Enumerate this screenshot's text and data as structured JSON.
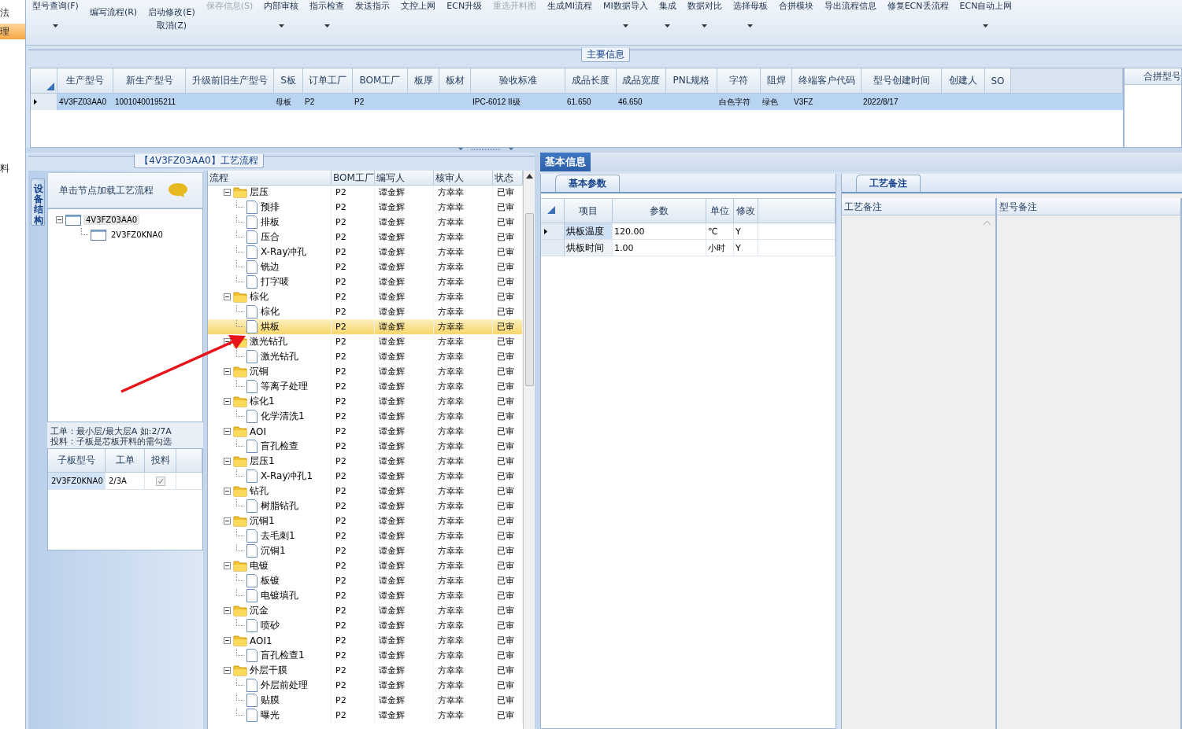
{
  "left_strip": [
    {
      "label": "法",
      "selected": false
    },
    {
      "label": "理",
      "selected": true
    },
    {
      "label": "料",
      "selected": false
    }
  ],
  "toolbar": [
    {
      "label": "型号查询(F)",
      "kind": "top",
      "disabled": false,
      "dropdown": true
    },
    {
      "label": "编写流程(R)",
      "kind": "large",
      "disabled": false,
      "dropdown": false
    },
    {
      "label": "启动修改(E)",
      "kind": "large",
      "disabled": false,
      "dropdown": false,
      "secondary": "取消(Z)"
    },
    {
      "label": "保存信息(S)",
      "kind": "top",
      "disabled": true,
      "dropdown": false
    },
    {
      "label": "内部审核",
      "kind": "top",
      "disabled": false,
      "dropdown": true
    },
    {
      "label": "指示检查",
      "kind": "top",
      "disabled": false,
      "dropdown": true
    },
    {
      "label": "发送指示",
      "kind": "top",
      "disabled": false,
      "dropdown": false
    },
    {
      "label": "文控上网",
      "kind": "top",
      "disabled": false,
      "dropdown": false
    },
    {
      "label": "ECN升级",
      "kind": "top",
      "disabled": false,
      "dropdown": false
    },
    {
      "label": "重选开料图",
      "kind": "top",
      "disabled": true,
      "dropdown": false
    },
    {
      "label": "生成MI流程",
      "kind": "top",
      "disabled": false,
      "dropdown": false
    },
    {
      "label": "MI数据导入",
      "kind": "top",
      "disabled": false,
      "dropdown": true
    },
    {
      "label": "集成",
      "kind": "top",
      "disabled": false,
      "dropdown": true
    },
    {
      "label": "数据对比",
      "kind": "top",
      "disabled": false,
      "dropdown": true
    },
    {
      "label": "选择母板",
      "kind": "top",
      "disabled": false,
      "dropdown": true
    },
    {
      "label": "合拼模块",
      "kind": "top",
      "disabled": false,
      "dropdown": false
    },
    {
      "label": "导出流程信息",
      "kind": "top",
      "disabled": false,
      "dropdown": false
    },
    {
      "label": "修复ECN丢流程",
      "kind": "top",
      "disabled": false,
      "dropdown": false
    },
    {
      "label": "ECN自动上网",
      "kind": "top",
      "disabled": false,
      "dropdown": true
    }
  ],
  "main_info": {
    "title": "主要信息",
    "columns": [
      "生产型号",
      "新生产型号",
      "升级前旧生产型号",
      "S板",
      "订单工厂",
      "BOM工厂",
      "板厚",
      "板材",
      "验收标准",
      "成品长度",
      "成品宽度",
      "PNL规格",
      "字符",
      "阻焊",
      "终端客户代码",
      "型号创建时间",
      "创建人",
      "SO"
    ],
    "rows": [
      {
        "current": true,
        "cells": [
          "4V3FZ03AA0",
          "10010400195211",
          null,
          "母板",
          "P2",
          "P2",
          null,
          null,
          "IPC-6012 II级",
          "61.650",
          "46.650",
          null,
          "白色字符",
          "绿色",
          "V3FZ",
          "2022/8/17",
          null,
          null
        ]
      }
    ],
    "side_column": "合拼型号"
  },
  "device_panel": {
    "tab": "设备结构",
    "hint": "单击节点加载工艺流程",
    "tree": [
      {
        "name": "4V3FZ03AA0",
        "expanded": true,
        "selected": true,
        "children": [
          {
            "name": "2V3FZ0KNA0",
            "selected": false
          }
        ]
      }
    ],
    "note": "工单：最小层/最大层A 如:2/7A\n投料：子板是芯板开料的需勾选",
    "sub_columns": [
      "子板型号",
      "工单",
      "投料"
    ],
    "sub_rows": [
      {
        "board": "2V3FZ0KNA0",
        "order": "2/3A",
        "checked": true
      }
    ]
  },
  "flow": {
    "title": "【4V3FZ03AA0】工艺流程",
    "columns": [
      "流程",
      "BOM工厂",
      "编写人",
      "核审人",
      "状态"
    ],
    "tree": [
      {
        "name": "层压",
        "kind": "folder",
        "bom": "P2",
        "author": "谭金辉",
        "reviewer": "方幸幸",
        "status": "已审",
        "selected": false,
        "expanded": true,
        "children": [
          {
            "name": "预排",
            "kind": "step",
            "bom": "P2",
            "author": "谭金辉",
            "reviewer": "方幸幸",
            "status": "已审",
            "selected": false
          },
          {
            "name": "排板",
            "kind": "step",
            "bom": "P2",
            "author": "谭金辉",
            "reviewer": "方幸幸",
            "status": "已审",
            "selected": false
          },
          {
            "name": "压合",
            "kind": "step",
            "bom": "P2",
            "author": "谭金辉",
            "reviewer": "方幸幸",
            "status": "已审",
            "selected": false
          },
          {
            "name": "X-Ray冲孔",
            "kind": "step",
            "bom": "P2",
            "author": "谭金辉",
            "reviewer": "方幸幸",
            "status": "已审",
            "selected": false
          },
          {
            "name": "铣边",
            "kind": "step",
            "bom": "P2",
            "author": "谭金辉",
            "reviewer": "方幸幸",
            "status": "已审",
            "selected": false
          },
          {
            "name": "打字唛",
            "kind": "step",
            "bom": "P2",
            "author": "谭金辉",
            "reviewer": "方幸幸",
            "status": "已审",
            "selected": false
          }
        ]
      },
      {
        "name": "棕化",
        "kind": "folder",
        "bom": "P2",
        "author": "谭金辉",
        "reviewer": "方幸幸",
        "status": "已审",
        "selected": false,
        "expanded": true,
        "children": [
          {
            "name": "棕化",
            "kind": "step",
            "bom": "P2",
            "author": "谭金辉",
            "reviewer": "方幸幸",
            "status": "已审",
            "selected": false
          },
          {
            "name": "烘板",
            "kind": "step",
            "bom": "P2",
            "author": "谭金辉",
            "reviewer": "方幸幸",
            "status": "已审",
            "selected": true
          }
        ]
      },
      {
        "name": "激光钻孔",
        "kind": "folder",
        "bom": "P2",
        "author": "谭金辉",
        "reviewer": "方幸幸",
        "status": "已审",
        "selected": false,
        "expanded": true,
        "children": [
          {
            "name": "激光钻孔",
            "kind": "step",
            "bom": "P2",
            "author": "谭金辉",
            "reviewer": "方幸幸",
            "status": "已审",
            "selected": false
          }
        ]
      },
      {
        "name": "沉铜",
        "kind": "folder",
        "bom": "P2",
        "author": "谭金辉",
        "reviewer": "方幸幸",
        "status": "已审",
        "selected": false,
        "expanded": true,
        "children": [
          {
            "name": "等离子处理",
            "kind": "step",
            "bom": "P2",
            "author": "谭金辉",
            "reviewer": "方幸幸",
            "status": "已审",
            "selected": false
          }
        ]
      },
      {
        "name": "棕化1",
        "kind": "folder",
        "bom": "P2",
        "author": "谭金辉",
        "reviewer": "方幸幸",
        "status": "已审",
        "selected": false,
        "expanded": true,
        "children": [
          {
            "name": "化学清洗1",
            "kind": "step",
            "bom": "P2",
            "author": "谭金辉",
            "reviewer": "方幸幸",
            "status": "已审",
            "selected": false
          }
        ]
      },
      {
        "name": "AOI",
        "kind": "folder",
        "bom": "P2",
        "author": "谭金辉",
        "reviewer": "方幸幸",
        "status": "已审",
        "selected": false,
        "expanded": true,
        "children": [
          {
            "name": "盲孔检查",
            "kind": "step",
            "bom": "P2",
            "author": "谭金辉",
            "reviewer": "方幸幸",
            "status": "已审",
            "selected": false
          }
        ]
      },
      {
        "name": "层压1",
        "kind": "folder",
        "bom": "P2",
        "author": "谭金辉",
        "reviewer": "方幸幸",
        "status": "已审",
        "selected": false,
        "expanded": true,
        "children": [
          {
            "name": "X-Ray冲孔1",
            "kind": "step",
            "bom": "P2",
            "author": "谭金辉",
            "reviewer": "方幸幸",
            "status": "已审",
            "selected": false
          }
        ]
      },
      {
        "name": "钻孔",
        "kind": "folder",
        "bom": "P2",
        "author": "谭金辉",
        "reviewer": "方幸幸",
        "status": "已审",
        "selected": false,
        "expanded": true,
        "children": [
          {
            "name": "树脂钻孔",
            "kind": "step",
            "bom": "P2",
            "author": "谭金辉",
            "reviewer": "方幸幸",
            "status": "已审",
            "selected": false
          }
        ]
      },
      {
        "name": "沉铜1",
        "kind": "folder",
        "bom": "P2",
        "author": "谭金辉",
        "reviewer": "方幸幸",
        "status": "已审",
        "selected": false,
        "expanded": true,
        "children": [
          {
            "name": "去毛刺1",
            "kind": "step",
            "bom": "P2",
            "author": "谭金辉",
            "reviewer": "方幸幸",
            "status": "已审",
            "selected": false
          },
          {
            "name": "沉铜1",
            "kind": "step",
            "bom": "P2",
            "author": "谭金辉",
            "reviewer": "方幸幸",
            "status": "已审",
            "selected": false
          }
        ]
      },
      {
        "name": "电镀",
        "kind": "folder",
        "bom": "P2",
        "author": "谭金辉",
        "reviewer": "方幸幸",
        "status": "已审",
        "selected": false,
        "expanded": true,
        "children": [
          {
            "name": "板镀",
            "kind": "step",
            "bom": "P2",
            "author": "谭金辉",
            "reviewer": "方幸幸",
            "status": "已审",
            "selected": false
          },
          {
            "name": "电镀填孔",
            "kind": "step",
            "bom": "P2",
            "author": "谭金辉",
            "reviewer": "方幸幸",
            "status": "已审",
            "selected": false
          }
        ]
      },
      {
        "name": "沉金",
        "kind": "folder",
        "bom": "P2",
        "author": "谭金辉",
        "reviewer": "方幸幸",
        "status": "已审",
        "selected": false,
        "expanded": true,
        "children": [
          {
            "name": "喷砂",
            "kind": "step",
            "bom": "P2",
            "author": "谭金辉",
            "reviewer": "方幸幸",
            "status": "已审",
            "selected": false
          }
        ]
      },
      {
        "name": "AOI1",
        "kind": "folder",
        "bom": "P2",
        "author": "谭金辉",
        "reviewer": "方幸幸",
        "status": "已审",
        "selected": false,
        "expanded": true,
        "children": [
          {
            "name": "盲孔检查1",
            "kind": "step",
            "bom": "P2",
            "author": "谭金辉",
            "reviewer": "方幸幸",
            "status": "已审",
            "selected": false
          }
        ]
      },
      {
        "name": "外层干膜",
        "kind": "folder",
        "bom": "P2",
        "author": "谭金辉",
        "reviewer": "方幸幸",
        "status": "已审",
        "selected": false,
        "expanded": true,
        "children": [
          {
            "name": "外层前处理",
            "kind": "step",
            "bom": "P2",
            "author": "谭金辉",
            "reviewer": "方幸幸",
            "status": "已审",
            "selected": false
          },
          {
            "name": "贴膜",
            "kind": "step",
            "bom": "P2",
            "author": "谭金辉",
            "reviewer": "方幸幸",
            "status": "已审",
            "selected": false
          },
          {
            "name": "曝光",
            "kind": "step",
            "bom": "P2",
            "author": "谭金辉",
            "reviewer": "方幸幸",
            "status": "已审",
            "selected": false
          }
        ]
      }
    ]
  },
  "detail": {
    "tabs": [
      {
        "label": "基本信息",
        "selected": true
      }
    ],
    "params": {
      "tab": "基本参数",
      "columns": [
        "项目",
        "参数",
        "单位",
        "修改"
      ],
      "rows": [
        {
          "current": true,
          "item": "烘板温度",
          "value": "120.00",
          "unit": "℃",
          "modified": "Y"
        },
        {
          "current": false,
          "item": "烘板时间",
          "value": "1.00",
          "unit": "小时",
          "modified": "Y"
        }
      ]
    },
    "notes": {
      "tab": "工艺备注",
      "columns": [
        "工艺备注",
        "型号备注"
      ]
    }
  }
}
